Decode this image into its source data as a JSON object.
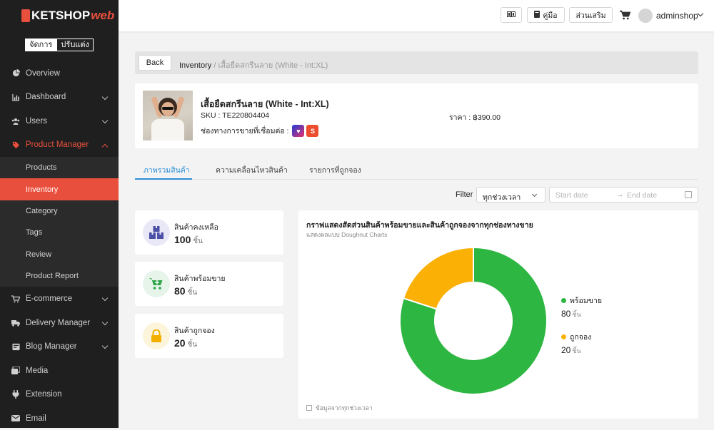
{
  "brand": {
    "name": "KETSHOP",
    "suffix": "web"
  },
  "mode": {
    "manage": "จัดการ",
    "customize": "ปรับแต่ง"
  },
  "sidebar": {
    "items": [
      {
        "label": "Overview",
        "icon": "pie-chart-icon"
      },
      {
        "label": "Dashboard",
        "icon": "bar-chart-icon"
      },
      {
        "label": "Users",
        "icon": "users-icon"
      },
      {
        "label": "Product Manager",
        "icon": "tag-icon"
      }
    ],
    "sub_items": [
      "Products",
      "Inventory",
      "Category",
      "Tags",
      "Review",
      "Product Report"
    ],
    "items_after": [
      {
        "label": "E-commerce",
        "icon": "cart-icon"
      },
      {
        "label": "Delivery Manager",
        "icon": "truck-icon"
      },
      {
        "label": "Blog Manager",
        "icon": "blog-icon"
      },
      {
        "label": "Media",
        "icon": "media-icon"
      },
      {
        "label": "Extension",
        "icon": "plug-icon"
      },
      {
        "label": "Email",
        "icon": "mail-icon"
      }
    ]
  },
  "topbar": {
    "manual": "คู่มือ",
    "addons": "ส่วนเสริม",
    "username": "adminshop"
  },
  "breadcrumb": {
    "back": "Back",
    "parent": "Inventory",
    "separator": "/",
    "current": "เสื้อยืดสกรีนลาย (White - Int:XL)"
  },
  "product": {
    "title": "เสื้อยืดสกรีนลาย (White - Int:XL)",
    "sku": "SKU : TE220804404",
    "channels_label": "ช่องทางการขายที่เชื่อมต่อ :",
    "price": "ราคา : ฿390.00"
  },
  "tabs": [
    "ภาพรวมสินค้า",
    "ความเคลื่อนไหวสินค้า",
    "รายการที่ถูกจอง"
  ],
  "filter": {
    "label": "Filter",
    "period": "ทุกช่วงเวลา",
    "start_placeholder": "Start date",
    "end_placeholder": "End date"
  },
  "stats": [
    {
      "label": "สินค้าคงเหลือ",
      "value": "100",
      "unit": "ชิ้น",
      "icon": "boxes-icon",
      "color": "#4b4fa6",
      "bg": "#e9e8f6"
    },
    {
      "label": "สินค้าพร้อมขาย",
      "value": "80",
      "unit": "ชิ้น",
      "icon": "cart-plus-icon",
      "color": "#2fa44a",
      "bg": "#e6f4ea"
    },
    {
      "label": "สินค้าถูกจอง",
      "value": "20",
      "unit": "ชิ้น",
      "icon": "lock-icon",
      "color": "#f3b000",
      "bg": "#fdf4dc"
    }
  ],
  "chart": {
    "title": "กราฟแสดงสัดส่วนสินค้าพร้อมขายและสินค้าถูกจองจากทุกช่องทางขาย",
    "subtitle": "แสดงผลแบบ Doughnut Charts",
    "footer": "ข้อมูลจากทุกช่วงเวลา",
    "unit": "ชิ้น"
  },
  "chart_data": {
    "type": "pie",
    "categories": [
      "พร้อมขาย",
      "ถูกจอง"
    ],
    "values": [
      80,
      20
    ],
    "colors": [
      "#2db642",
      "#fbb005"
    ]
  }
}
